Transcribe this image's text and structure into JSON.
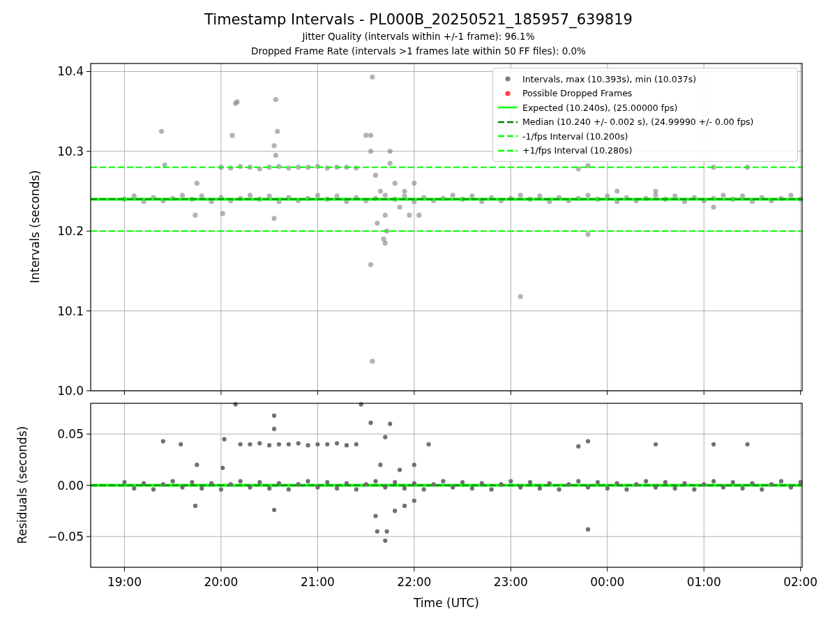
{
  "title": "Timestamp Intervals - PL000B_20250521_185957_639819",
  "subtitles": [
    "Jitter Quality (intervals within +/-1 frame): 96.1%",
    "Dropped Frame Rate (intervals >1 frames late within 50 FF files): 0.0%"
  ],
  "top_panel": {
    "chart_data": {
      "type": "scatter",
      "ylabel": "Intervals (seconds)",
      "grid": true,
      "xlim": [
        "2025-05-21T18:39",
        "2025-05-22T02:01"
      ],
      "ylim": [
        10.0,
        10.41
      ],
      "yticks": [
        {
          "value": 10.0,
          "label": "10.0"
        },
        {
          "value": 10.1,
          "label": "10.1"
        },
        {
          "value": 10.2,
          "label": "10.2"
        },
        {
          "value": 10.3,
          "label": "10.3"
        },
        {
          "value": 10.4,
          "label": "10.4"
        }
      ],
      "series": [
        {
          "name": "Intervals, max (10.393s), min (10.037s)",
          "color": "#808080",
          "x": [
            "2025-05-21T19:00",
            "2025-05-21T19:06",
            "2025-05-21T19:12",
            "2025-05-21T19:18",
            "2025-05-21T19:24",
            "2025-05-21T19:30",
            "2025-05-21T19:36",
            "2025-05-21T19:42",
            "2025-05-21T19:48",
            "2025-05-21T19:54",
            "2025-05-21T20:00",
            "2025-05-21T20:06",
            "2025-05-21T20:12",
            "2025-05-21T20:18",
            "2025-05-21T20:24",
            "2025-05-21T20:30",
            "2025-05-21T20:36",
            "2025-05-21T20:42",
            "2025-05-21T20:48",
            "2025-05-21T20:54",
            "2025-05-21T21:00",
            "2025-05-21T21:06",
            "2025-05-21T21:12",
            "2025-05-21T21:18",
            "2025-05-21T21:24",
            "2025-05-21T21:30",
            "2025-05-21T21:36",
            "2025-05-21T21:42",
            "2025-05-21T21:48",
            "2025-05-21T21:54",
            "2025-05-21T22:00",
            "2025-05-21T22:06",
            "2025-05-21T22:12",
            "2025-05-21T22:18",
            "2025-05-21T22:24",
            "2025-05-21T22:30",
            "2025-05-21T22:36",
            "2025-05-21T22:42",
            "2025-05-21T22:48",
            "2025-05-21T22:54",
            "2025-05-21T23:00",
            "2025-05-21T23:06",
            "2025-05-21T23:12",
            "2025-05-21T23:18",
            "2025-05-21T23:24",
            "2025-05-21T23:30",
            "2025-05-21T23:36",
            "2025-05-21T23:42",
            "2025-05-21T23:48",
            "2025-05-21T23:54",
            "2025-05-22T00:00",
            "2025-05-22T00:06",
            "2025-05-22T00:12",
            "2025-05-22T00:18",
            "2025-05-22T00:24",
            "2025-05-22T00:30",
            "2025-05-22T00:36",
            "2025-05-22T00:42",
            "2025-05-22T00:48",
            "2025-05-22T00:54",
            "2025-05-22T01:00",
            "2025-05-22T01:06",
            "2025-05-22T01:12",
            "2025-05-22T01:18",
            "2025-05-22T01:24",
            "2025-05-22T01:30",
            "2025-05-22T01:36",
            "2025-05-22T01:42",
            "2025-05-22T01:48",
            "2025-05-22T01:54",
            "2025-05-22T02:00",
            "2025-05-21T20:00",
            "2025-05-21T20:06",
            "2025-05-21T20:12",
            "2025-05-21T20:18",
            "2025-05-21T20:24",
            "2025-05-21T20:30",
            "2025-05-21T20:36",
            "2025-05-21T20:42",
            "2025-05-21T20:48",
            "2025-05-21T20:54",
            "2025-05-21T21:00",
            "2025-05-21T21:06",
            "2025-05-21T21:12",
            "2025-05-21T21:18",
            "2025-05-21T21:24",
            "2025-05-21T21:36",
            "2025-05-21T21:39",
            "2025-05-21T21:42",
            "2025-05-21T21:41",
            "2025-05-21T21:43",
            "2025-05-21T21:48",
            "2025-05-21T21:51",
            "2025-05-21T21:54",
            "2025-05-21T21:57",
            "2025-05-21T22:00",
            "2025-05-21T22:03",
            "2025-05-21T21:45",
            "2025-05-21T21:37",
            "2025-05-21T21:42",
            "2025-05-21T19:23",
            "2025-05-21T20:09",
            "2025-05-21T20:10",
            "2025-05-21T20:07",
            "2025-05-21T20:34",
            "2025-05-21T20:35",
            "2025-05-21T21:34",
            "2025-05-21T21:30",
            "2025-05-21T21:33",
            "2025-05-21T20:33",
            "2025-05-21T20:34",
            "2025-05-21T21:33",
            "2025-05-21T21:45",
            "2025-05-21T23:06",
            "2025-05-21T21:34",
            "2025-05-21T21:33",
            "2025-05-21T19:25",
            "2025-05-21T19:45",
            "2025-05-21T19:44",
            "2025-05-21T20:01",
            "2025-05-21T20:33",
            "2025-05-21T23:48",
            "2025-05-21T23:48",
            "2025-05-22T00:06",
            "2025-05-22T01:06",
            "2025-05-22T00:30",
            "2025-05-22T01:06",
            "2025-05-22T01:27",
            "2025-05-21T23:42"
          ],
          "values": [
            10.24,
            10.244,
            10.237,
            10.242,
            10.238,
            10.241,
            10.245,
            10.24,
            10.244,
            10.237,
            10.242,
            10.238,
            10.241,
            10.245,
            10.24,
            10.244,
            10.237,
            10.242,
            10.238,
            10.241,
            10.245,
            10.24,
            10.244,
            10.237,
            10.242,
            10.238,
            10.241,
            10.245,
            10.24,
            10.244,
            10.237,
            10.242,
            10.238,
            10.241,
            10.245,
            10.24,
            10.244,
            10.237,
            10.242,
            10.238,
            10.241,
            10.245,
            10.24,
            10.244,
            10.237,
            10.242,
            10.238,
            10.241,
            10.245,
            10.24,
            10.244,
            10.237,
            10.242,
            10.238,
            10.241,
            10.245,
            10.24,
            10.244,
            10.237,
            10.242,
            10.238,
            10.241,
            10.245,
            10.24,
            10.244,
            10.237,
            10.242,
            10.238,
            10.241,
            10.245,
            10.24,
            10.28,
            10.279,
            10.281,
            10.28,
            10.278,
            10.28,
            10.281,
            10.279,
            10.28,
            10.28,
            10.281,
            10.279,
            10.28,
            10.28,
            10.279,
            10.27,
            10.25,
            10.22,
            10.19,
            10.2,
            10.26,
            10.23,
            10.25,
            10.22,
            10.26,
            10.22,
            10.285,
            10.21,
            10.185,
            10.325,
            10.36,
            10.362,
            10.32,
            10.365,
            10.325,
            10.393,
            10.32,
            10.32,
            10.307,
            10.295,
            10.3,
            10.3,
            10.118,
            10.037,
            10.158,
            10.283,
            10.26,
            10.22,
            10.222,
            10.216,
            10.196,
            10.282,
            10.25,
            10.23,
            10.25,
            10.28,
            10.28,
            10.278
          ]
        },
        {
          "name": "Possible Dropped Frames",
          "color": "#ff4040"
        }
      ],
      "ref_lines": [
        {
          "axis": "y",
          "value": 10.24,
          "label": "Expected (10.240s), (25.00000 fps)",
          "color": "#00ff00"
        },
        {
          "axis": "y",
          "value": 10.24,
          "label": "Median (10.240 +/- 0.002 s), (24.99990 +/- 0.00 fps)",
          "color": "#008000"
        },
        {
          "axis": "y",
          "value": 10.2,
          "label": "-1/fps Interval (10.200s)",
          "color": "#00ff00"
        },
        {
          "axis": "y",
          "value": 10.28,
          "label": "+1/fps Interval (10.280s)",
          "color": "#00ff00"
        }
      ]
    }
  },
  "bottom_panel": {
    "chart_data": {
      "type": "scatter",
      "xlabel": "Time (UTC)",
      "ylabel": "Residuals (seconds)",
      "grid": true,
      "xlim": [
        "2025-05-21T18:39",
        "2025-05-22T02:01"
      ],
      "ylim": [
        -0.08,
        0.08
      ],
      "xticks": [
        {
          "value": "2025-05-21T19:00",
          "label": "19:00"
        },
        {
          "value": "2025-05-21T20:00",
          "label": "20:00"
        },
        {
          "value": "2025-05-21T21:00",
          "label": "21:00"
        },
        {
          "value": "2025-05-21T22:00",
          "label": "22:00"
        },
        {
          "value": "2025-05-21T23:00",
          "label": "23:00"
        },
        {
          "value": "2025-05-22T00:00",
          "label": "00:00"
        },
        {
          "value": "2025-05-22T01:00",
          "label": "01:00"
        },
        {
          "value": "2025-05-22T02:00",
          "label": "02:00"
        }
      ],
      "yticks": [
        {
          "value": -0.05,
          "label": "−0.05"
        },
        {
          "value": 0,
          "label": "0.00"
        },
        {
          "value": 0.05,
          "label": "0.05"
        }
      ],
      "series": [
        {
          "color": "#707070",
          "x": [
            "2025-05-21T19:00",
            "2025-05-21T19:06",
            "2025-05-21T19:12",
            "2025-05-21T19:18",
            "2025-05-21T19:24",
            "2025-05-21T19:30",
            "2025-05-21T19:36",
            "2025-05-21T19:42",
            "2025-05-21T19:48",
            "2025-05-21T19:54",
            "2025-05-21T20:00",
            "2025-05-21T20:06",
            "2025-05-21T20:12",
            "2025-05-21T20:18",
            "2025-05-21T20:24",
            "2025-05-21T20:30",
            "2025-05-21T20:36",
            "2025-05-21T20:42",
            "2025-05-21T20:48",
            "2025-05-21T20:54",
            "2025-05-21T21:00",
            "2025-05-21T21:06",
            "2025-05-21T21:12",
            "2025-05-21T21:18",
            "2025-05-21T21:24",
            "2025-05-21T21:30",
            "2025-05-21T21:36",
            "2025-05-21T21:42",
            "2025-05-21T21:48",
            "2025-05-21T21:54",
            "2025-05-21T22:00",
            "2025-05-21T22:06",
            "2025-05-21T22:12",
            "2025-05-21T22:18",
            "2025-05-21T22:24",
            "2025-05-21T22:30",
            "2025-05-21T22:36",
            "2025-05-21T22:42",
            "2025-05-21T22:48",
            "2025-05-21T22:54",
            "2025-05-21T23:00",
            "2025-05-21T23:06",
            "2025-05-21T23:12",
            "2025-05-21T23:18",
            "2025-05-21T23:24",
            "2025-05-21T23:30",
            "2025-05-21T23:36",
            "2025-05-21T23:42",
            "2025-05-21T23:48",
            "2025-05-21T23:54",
            "2025-05-22T00:00",
            "2025-05-22T00:06",
            "2025-05-22T00:12",
            "2025-05-22T00:18",
            "2025-05-22T00:24",
            "2025-05-22T00:30",
            "2025-05-22T00:36",
            "2025-05-22T00:42",
            "2025-05-22T00:48",
            "2025-05-22T00:54",
            "2025-05-22T01:00",
            "2025-05-22T01:06",
            "2025-05-22T01:12",
            "2025-05-22T01:18",
            "2025-05-22T01:24",
            "2025-05-22T01:30",
            "2025-05-22T01:36",
            "2025-05-22T01:42",
            "2025-05-22T01:48",
            "2025-05-22T01:54",
            "2025-05-22T02:00",
            "2025-05-21T20:12",
            "2025-05-21T20:18",
            "2025-05-21T20:24",
            "2025-05-21T20:30",
            "2025-05-21T20:36",
            "2025-05-21T20:42",
            "2025-05-21T20:48",
            "2025-05-21T20:54",
            "2025-05-21T21:00",
            "2025-05-21T21:06",
            "2025-05-21T21:12",
            "2025-05-21T21:18",
            "2025-05-21T21:24",
            "2025-05-21T20:09",
            "2025-05-21T21:27",
            "2025-05-21T20:33",
            "2025-05-21T20:33",
            "2025-05-21T19:24",
            "2025-05-21T19:35",
            "2025-05-21T20:02",
            "2025-05-21T21:33",
            "2025-05-21T21:45",
            "2025-05-21T21:42",
            "2025-05-21T22:09",
            "2025-05-21T23:42",
            "2025-05-21T23:48",
            "2025-05-22T00:30",
            "2025-05-22T01:06",
            "2025-05-22T01:27",
            "2025-05-21T23:48",
            "2025-05-21T21:42",
            "2025-05-21T21:37",
            "2025-05-21T21:43",
            "2025-05-21T21:36",
            "2025-05-21T21:48",
            "2025-05-21T21:54",
            "2025-05-21T22:00",
            "2025-05-21T21:39",
            "2025-05-21T21:51",
            "2025-05-21T22:00",
            "2025-05-21T19:45",
            "2025-05-21T20:01",
            "2025-05-21T19:44",
            "2025-05-21T20:33"
          ],
          "values": [
            0.003,
            -0.003,
            0.002,
            -0.004,
            0.001,
            0.004,
            -0.002,
            0.003,
            -0.003,
            0.002,
            -0.004,
            0.001,
            0.004,
            -0.002,
            0.003,
            -0.003,
            0.002,
            -0.004,
            0.001,
            0.004,
            -0.002,
            0.003,
            -0.003,
            0.002,
            -0.004,
            0.001,
            0.004,
            -0.002,
            0.003,
            -0.003,
            0.002,
            -0.004,
            0.001,
            0.004,
            -0.002,
            0.003,
            -0.003,
            0.002,
            -0.004,
            0.001,
            0.004,
            -0.002,
            0.003,
            -0.003,
            0.002,
            -0.004,
            0.001,
            0.004,
            -0.002,
            0.003,
            -0.003,
            0.002,
            -0.004,
            0.001,
            0.004,
            -0.002,
            0.003,
            -0.003,
            0.002,
            -0.004,
            0.001,
            0.004,
            -0.002,
            0.003,
            -0.003,
            0.002,
            -0.004,
            0.001,
            0.004,
            -0.002,
            0.003,
            0.04,
            0.04,
            0.041,
            0.039,
            0.04,
            0.04,
            0.041,
            0.039,
            0.04,
            0.04,
            0.041,
            0.039,
            0.04,
            0.079,
            0.079,
            0.068,
            0.055,
            0.043,
            0.04,
            0.045,
            0.061,
            0.06,
            0.047,
            0.04,
            0.038,
            0.043,
            0.04,
            0.04,
            0.04,
            -0.043,
            -0.054,
            -0.045,
            -0.045,
            -0.03,
            -0.025,
            -0.02,
            -0.015,
            0.02,
            0.015,
            0.02,
            0.02,
            0.017,
            -0.02,
            -0.024
          ]
        }
      ],
      "ref_lines": [
        {
          "axis": "y",
          "value": 0,
          "color": "#00ff00"
        },
        {
          "axis": "y",
          "value": 0,
          "color": "#008000"
        }
      ]
    }
  }
}
